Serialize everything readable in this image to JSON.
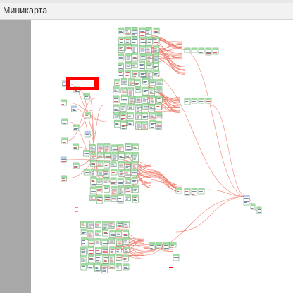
{
  "panel": {
    "title": "Миникарта"
  },
  "colors": {
    "gutter": "#a8a8a8",
    "connector": "#f08070",
    "node_header": "#9fdc9f",
    "node_body": "#ffffff",
    "node_border": "#6aa06a",
    "selection": "#ff0000",
    "blue_node": "#b9c9f2"
  }
}
